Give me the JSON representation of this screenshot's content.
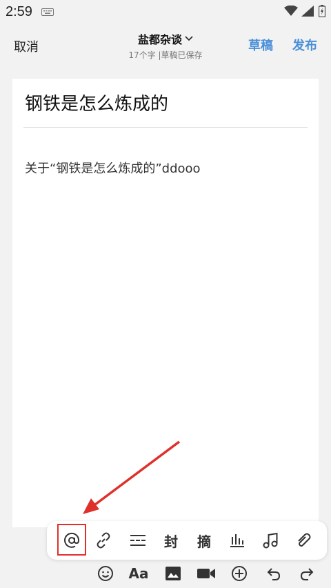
{
  "status": {
    "time": "2:59"
  },
  "header": {
    "cancel_label": "取消",
    "column_name": "盐都杂谈",
    "subtitle": "17个字 |草稿已保存",
    "drafts_label": "草稿",
    "publish_label": "发布"
  },
  "editor": {
    "title": "钢铁是怎么炼成的",
    "body": "关于“钢铁是怎么炼成的”ddooo"
  },
  "toolbar_top": {
    "items": [
      {
        "icon": "at-mention-icon"
      },
      {
        "icon": "link-icon"
      },
      {
        "icon": "divider-icon"
      },
      {
        "icon": "cover-icon",
        "label": "封"
      },
      {
        "icon": "excerpt-icon",
        "label": "摘"
      },
      {
        "icon": "chart-icon"
      },
      {
        "icon": "music-icon"
      },
      {
        "icon": "attachment-icon"
      }
    ]
  },
  "toolbar_bottom": {
    "text_format_label": "Aa",
    "items": [
      "emoji-icon",
      "text-format-icon",
      "image-icon",
      "video-icon",
      "add-icon",
      "undo-icon",
      "redo-icon"
    ]
  },
  "colors": {
    "accent": "#4a90d9",
    "highlight": "#e0302a",
    "background": "#f2f2f2"
  }
}
